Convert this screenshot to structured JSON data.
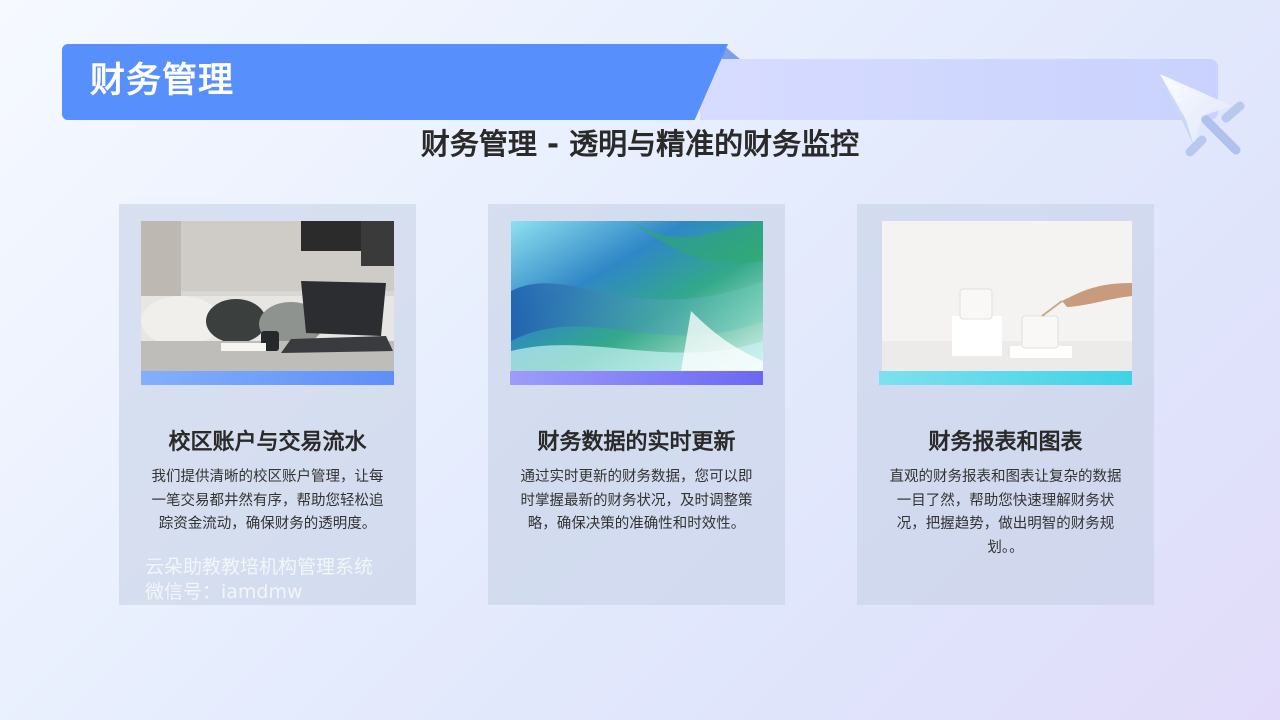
{
  "header": {
    "title": "财务管理",
    "subtitle": "财务管理 - 透明与精准的财务监控"
  },
  "cards": [
    {
      "image_icon": "laptop-desk-photo",
      "title": "校区账户与交易流水",
      "body": "我们提供清晰的校区账户管理，让每一笔交易都井然有序，帮助您轻松追踪资金流动，确保财务的透明度。",
      "accent": "#5d8ff8"
    },
    {
      "image_icon": "abstract-wave-photo",
      "title": "财务数据的实时更新",
      "body": "通过实时更新的财务数据，您可以即时掌握最新的财务状况，及时调整策略，确保决策的准确性和时效性。",
      "accent": "#6c68f4"
    },
    {
      "image_icon": "candles-photo",
      "title": "财务报表和图表",
      "body": "直观的财务报表和图表让复杂的数据一目了然，帮助您快速理解财务状况，把握趋势，做出明智的财务规划。。",
      "accent": "#3fd3e6"
    }
  ],
  "watermark": {
    "line1": "云朵助教教培机构管理系统",
    "line2": "微信号：iamdmw"
  },
  "colors": {
    "banner": "#578ffc",
    "banner_light": "#cfd6ff",
    "text": "#2a2a2a"
  }
}
